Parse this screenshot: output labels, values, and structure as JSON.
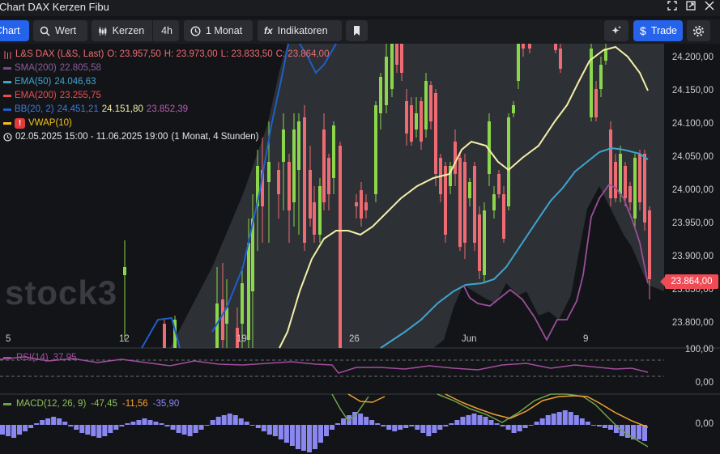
{
  "window": {
    "title": "Chart DAX Kerzen Fibu"
  },
  "toolbar": {
    "chart_label": "Chart",
    "wert_label": "Wert",
    "kerzen_label": "Kerzen",
    "interval_label": "4h",
    "period_label": "1 Monat",
    "indicators_label": "Indikatoren",
    "trade_label": "Trade"
  },
  "legend": {
    "instrument": "L&S DAX (L&S, Last)",
    "open": "O: 23.957,50",
    "high": "H: 23.973,00",
    "low": "L: 23.833,50",
    "close": "C: 23.864,00",
    "sma_label": "SMA(200)",
    "sma_value": "22.805,58",
    "ema50_label": "EMA(50)",
    "ema50_value": "24.046,63",
    "ema200_label": "EMA(200)",
    "ema200_value": "23.255,75",
    "bb_label": "BB(20, 2)",
    "bb_v1": "24.451,21",
    "bb_v2": "24.151,80",
    "bb_v3": "23.852,39",
    "vwap_label": "VWAP(10)",
    "range": "02.05.2025 15:00 - 11.06.2025 19:00",
    "range_note": "(1 Monat, 4 Stunden)"
  },
  "price_axis": [
    "24.200,00",
    "24.150,00",
    "24.100,00",
    "24.050,00",
    "24.000,00",
    "23.950,00",
    "23.900,00",
    "23.850,00",
    "23.800,00"
  ],
  "last_price": "23.864,00",
  "time_axis": [
    "5",
    "12",
    "19",
    "26",
    "Jun",
    "9"
  ],
  "watermark": "stock3",
  "rsi": {
    "label": "RSI(14)",
    "value": "37,95",
    "axis_top": "100,00",
    "axis_bottom": "0,00"
  },
  "macd": {
    "label": "MACD(12, 26, 9)",
    "v1": "-47,45",
    "v2": "-11,56",
    "v3": "-35,90",
    "axis_zero": "0,00"
  },
  "colors": {
    "up": "#8bd64a",
    "down": "#ef6b73",
    "vwap": "#f3f0a6",
    "ema50": "#3ea5cf",
    "ema200": "#ef4b55",
    "bb": "#1e5fc8",
    "sma": "#7a4a8a",
    "accent": "#2563eb"
  },
  "icons": [
    "chevron-left-icon",
    "search-icon",
    "candles-icon",
    "clock-icon",
    "fx-icon",
    "bookmark-icon",
    "sparkle-icon",
    "dollar-icon",
    "gear-icon",
    "fullscreen-icon",
    "popout-icon"
  ]
}
